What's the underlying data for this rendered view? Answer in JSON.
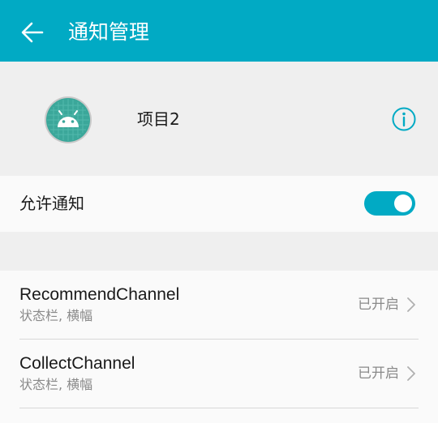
{
  "header": {
    "title": "通知管理",
    "back_icon": "back-arrow-icon",
    "background": "#01aac4"
  },
  "app": {
    "name": "项目2",
    "icon": "android-app-icon",
    "info_icon": "info-icon"
  },
  "allow_notifications": {
    "label": "允许通知",
    "enabled": true,
    "accent": "#01aac4"
  },
  "channels": [
    {
      "name": "RecommendChannel",
      "subtitle": "状态栏, 横幅",
      "status": "已开启"
    },
    {
      "name": "CollectChannel",
      "subtitle": "状态栏, 横幅",
      "status": "已开启"
    }
  ]
}
